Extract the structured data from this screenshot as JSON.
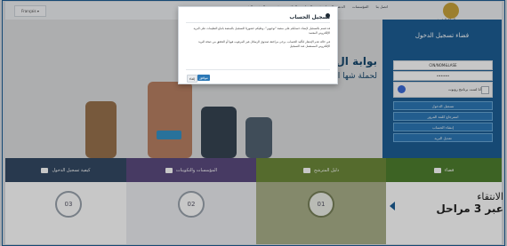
{
  "header": {
    "lang_label": "Français ▾",
    "nav": [
      "الصفحة الرئيسية",
      "تقديم",
      "المواعيد والوثائق",
      "الدعم والمساعدة",
      "المؤسسات",
      "اتصل بنا"
    ],
    "kingdom": "المملكة المغربية"
  },
  "hero": {
    "title": "بوابة ال",
    "subtitle": "لحملة شها المؤسسات"
  },
  "login": {
    "title": "فضاء تسجيل الدخول",
    "username_value": "CIN/NOM&LASE",
    "password_value": "••••••",
    "captcha_text": "أنا لست برنامج روبوت",
    "buttons": [
      "تسجيل الدخول",
      "استرجاع كلمة المرور",
      "إنشاء الحساب",
      "تعديل البريد"
    ]
  },
  "bands": {
    "b1": "كيفية تسجيل الدخول",
    "b2": "المؤسسات والتكوينات",
    "b3": "دليل المترشح",
    "b4": "فضاء"
  },
  "steps": {
    "n3": "03",
    "n2": "02",
    "n1": "01",
    "right1": "الانتقاء",
    "right2": "عبر 3 مراحل"
  },
  "modal": {
    "title": "تسجيل الحساب",
    "text1": "قد قمتم بالتسجيل لإنشاء حسابكم على منصة \"توجيهي\"، وعليكم حضوريًا التسجيل بالمنصة باتباع التعليمات على البريد الإلكتروني المعتمد",
    "text2": "في حالة عدم الإشعار لتأكيد الحساب، يرجى مراجعة صندوق الرسائل غير المرغوب فيها أو التحقق من صحة البريد الإلكتروني المستعمل عند التسجيل",
    "ok": "موافق",
    "cancel": "إلغاء"
  }
}
